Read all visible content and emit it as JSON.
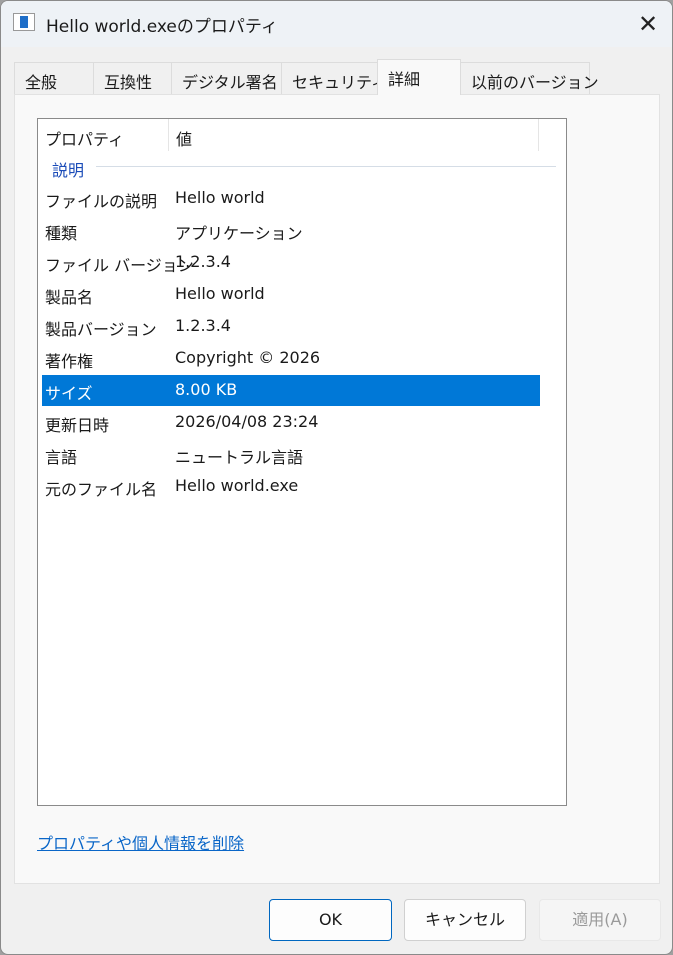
{
  "window": {
    "title": "Hello world.exeのプロパティ"
  },
  "tabs": [
    "全般",
    "互換性",
    "デジタル署名",
    "セキュリティ",
    "詳細",
    "以前のバージョン"
  ],
  "active_tab": "詳細",
  "list": {
    "headers": [
      "プロパティ",
      "値"
    ],
    "group": "説明",
    "rows": [
      {
        "k": "ファイルの説明",
        "v": "Hello world"
      },
      {
        "k": "種類",
        "v": "アプリケーション"
      },
      {
        "k": "ファイル バージョン",
        "v": "1.2.3.4"
      },
      {
        "k": "製品名",
        "v": "Hello world"
      },
      {
        "k": "製品バージョン",
        "v": "1.2.3.4"
      },
      {
        "k": "著作権",
        "v": "Copyright ©  2026"
      },
      {
        "k": "サイズ",
        "v": "8.00 KB"
      },
      {
        "k": "更新日時",
        "v": "2026/04/08 23:24"
      },
      {
        "k": "言語",
        "v": "ニュートラル言語"
      },
      {
        "k": "元のファイル名",
        "v": "Hello world.exe"
      }
    ],
    "selected_index": 6
  },
  "link": "プロパティや個人情報を削除",
  "buttons": {
    "ok": "OK",
    "cancel": "キャンセル",
    "apply": "適用(A)"
  },
  "colors": {
    "selection": "#0078d7",
    "link": "#0a66c8",
    "group": "#1a4bb8"
  }
}
